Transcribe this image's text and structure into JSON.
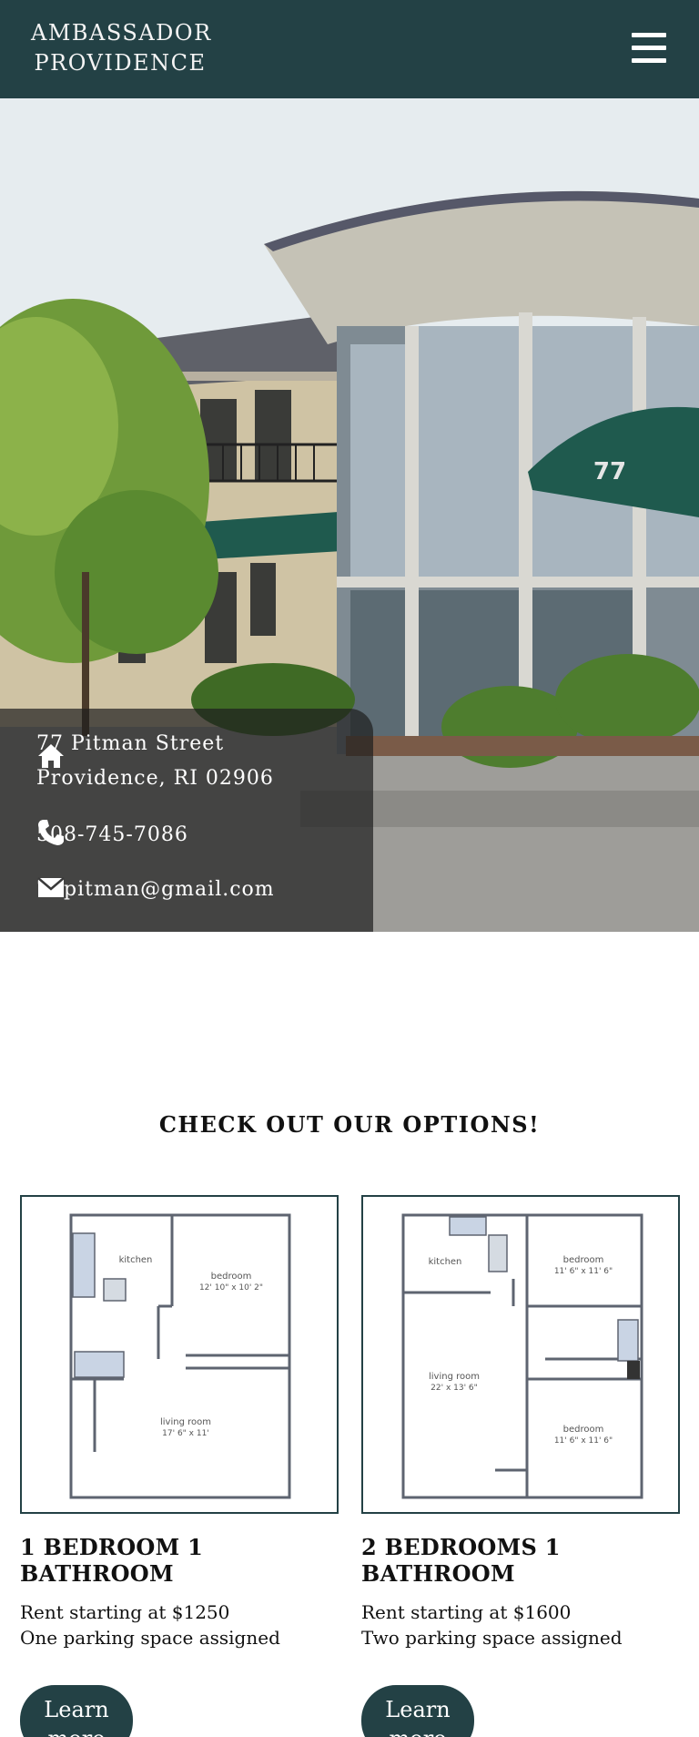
{
  "header": {
    "brand_line1": "AMBASSADOR",
    "brand_line2": "PROVIDENCE",
    "menu_icon": "hamburger-menu-icon",
    "background_color": "#234145"
  },
  "hero": {
    "image_label": "77",
    "contact": {
      "address_line1": "77 Pitman Street",
      "address_line2": "Providence, RI 02906",
      "phone": "508-745-7086",
      "email": "77pitman@gmail.com",
      "icons": [
        "home-icon",
        "phone-icon",
        "envelope-icon"
      ]
    }
  },
  "options": {
    "title": "CHECK OUT OUR OPTIONS!",
    "cards": [
      {
        "title": "1 BEDROOM 1 BATHROOM",
        "rent": "Rent starting at $1250",
        "parking": "One parking space assigned",
        "button": [
          "Learn",
          "more"
        ],
        "plan": {
          "kitchen": "kitchen",
          "bedroom": "bedroom",
          "bedroom_size": "12' 10\" x 10' 2\"",
          "living": "living room",
          "living_size": "17' 6\" x 11'"
        }
      },
      {
        "title": "2 BEDROOMS 1 BATHROOM",
        "rent": "Rent starting at $1600",
        "parking": "Two parking space assigned",
        "button": [
          "Learn",
          "more"
        ],
        "plan": {
          "kitchen": "kitchen",
          "bedroom1": "bedroom",
          "bedroom1_size": "11' 6\" x 11' 6\"",
          "living": "living room",
          "living_size": "22' x 13' 6\"",
          "bedroom2": "bedroom",
          "bedroom2_size": "11' 6\" x 11' 6\""
        }
      }
    ]
  },
  "colors": {
    "primary": "#234145",
    "text": "#111111",
    "overlay": "rgba(30,30,30,0.70)"
  }
}
